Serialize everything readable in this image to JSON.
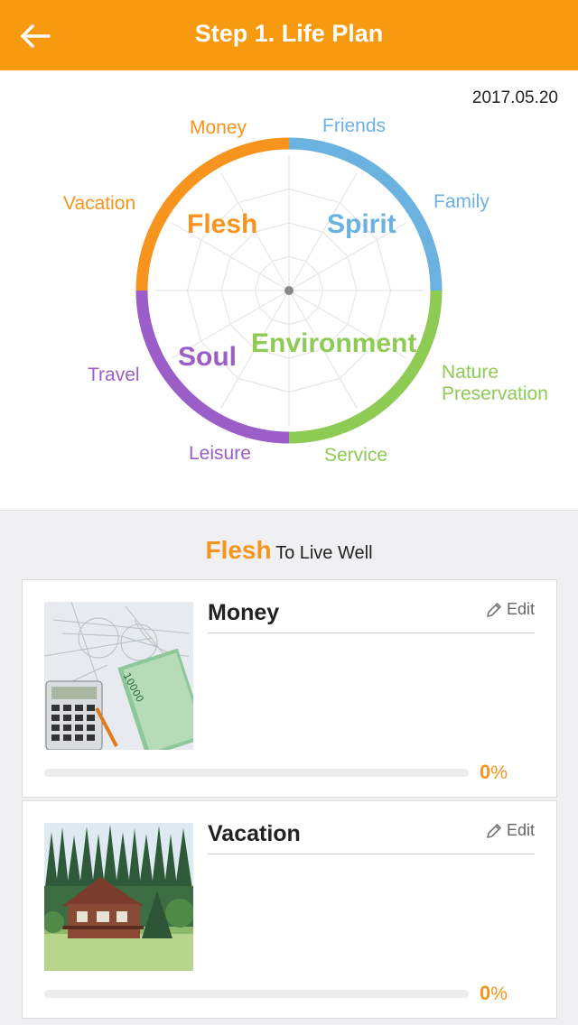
{
  "header": {
    "title": "Step 1. Life Plan",
    "back_icon": "arrow-left-icon"
  },
  "date": "2017.05.20",
  "wheel": {
    "colors": {
      "flesh": "#f7941d",
      "spirit": "#6cb2e0",
      "environment": "#8dcb55",
      "soul": "#9b5ec8"
    },
    "categories": {
      "flesh": "Flesh",
      "spirit": "Spirit",
      "environment": "Environment",
      "soul": "Soul"
    },
    "items": {
      "money": "Money",
      "friends": "Friends",
      "family": "Family",
      "vacation": "Vacation",
      "nature1": "Nature",
      "nature2": "Preservation",
      "travel": "Travel",
      "leisure": "Leisure",
      "service": "Service"
    }
  },
  "section": {
    "category": "Flesh",
    "subtitle": "To Live Well"
  },
  "cards": [
    {
      "title": "Money",
      "edit_label": "Edit",
      "progress_value": "0",
      "progress_unit": "%",
      "progress": 0
    },
    {
      "title": "Vacation",
      "edit_label": "Edit",
      "progress_value": "0",
      "progress_unit": "%",
      "progress": 0
    }
  ]
}
